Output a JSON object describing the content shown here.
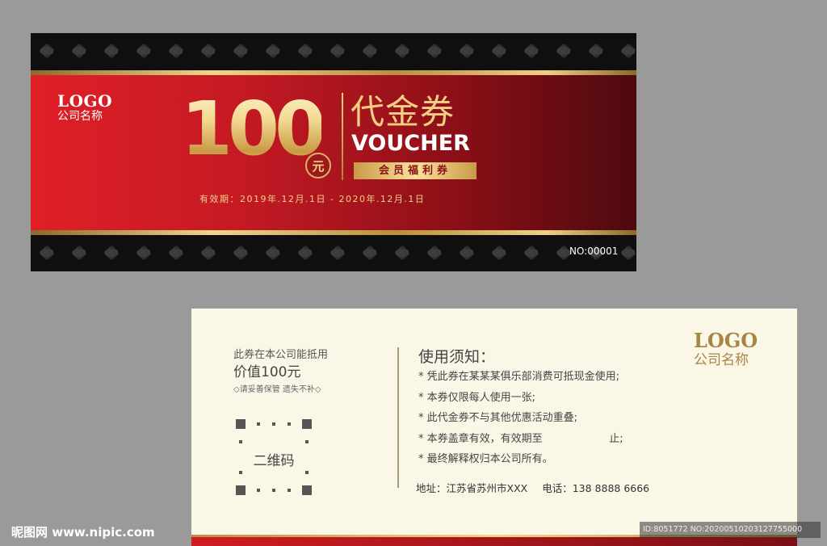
{
  "front": {
    "logo": "LOGO",
    "company": "公司名称",
    "amount": "100",
    "unit": "元",
    "title_cn": "代金券",
    "title_en": "VOUCHER",
    "tag": "会员福利券",
    "validity": "有效期：2019年.12月.1日 - 2020年.12月.1日",
    "serial": "NO:00001",
    "colors": {
      "red": "#e01f26",
      "dark_red": "#4d0a0e",
      "gold": "#f2cf84"
    }
  },
  "back": {
    "value_line1": "此券在本公司能抵用",
    "value_line2": "价值100元",
    "value_note": "◇请妥善保管 遗失不补◇",
    "qr_label": "二维码",
    "rules_title": "使用须知：",
    "rules": [
      "* 凭此券在某某某俱乐部消费可抵现金使用;",
      "* 本券仅限每人使用一张;",
      "* 此代金券不与其他优惠活动重叠;",
      "* 本券盖章有效，有效期至                    止;",
      "* 最终解释权归本公司所有。"
    ],
    "address": "地址：江苏省苏州市XXX",
    "phone": "电话：138 8888 6666",
    "logo": "LOGO",
    "company": "公司名称"
  },
  "watermark": {
    "site": "昵图网 www.nipic.com",
    "id": "ID:8051772 NO:20200510203127755000"
  }
}
